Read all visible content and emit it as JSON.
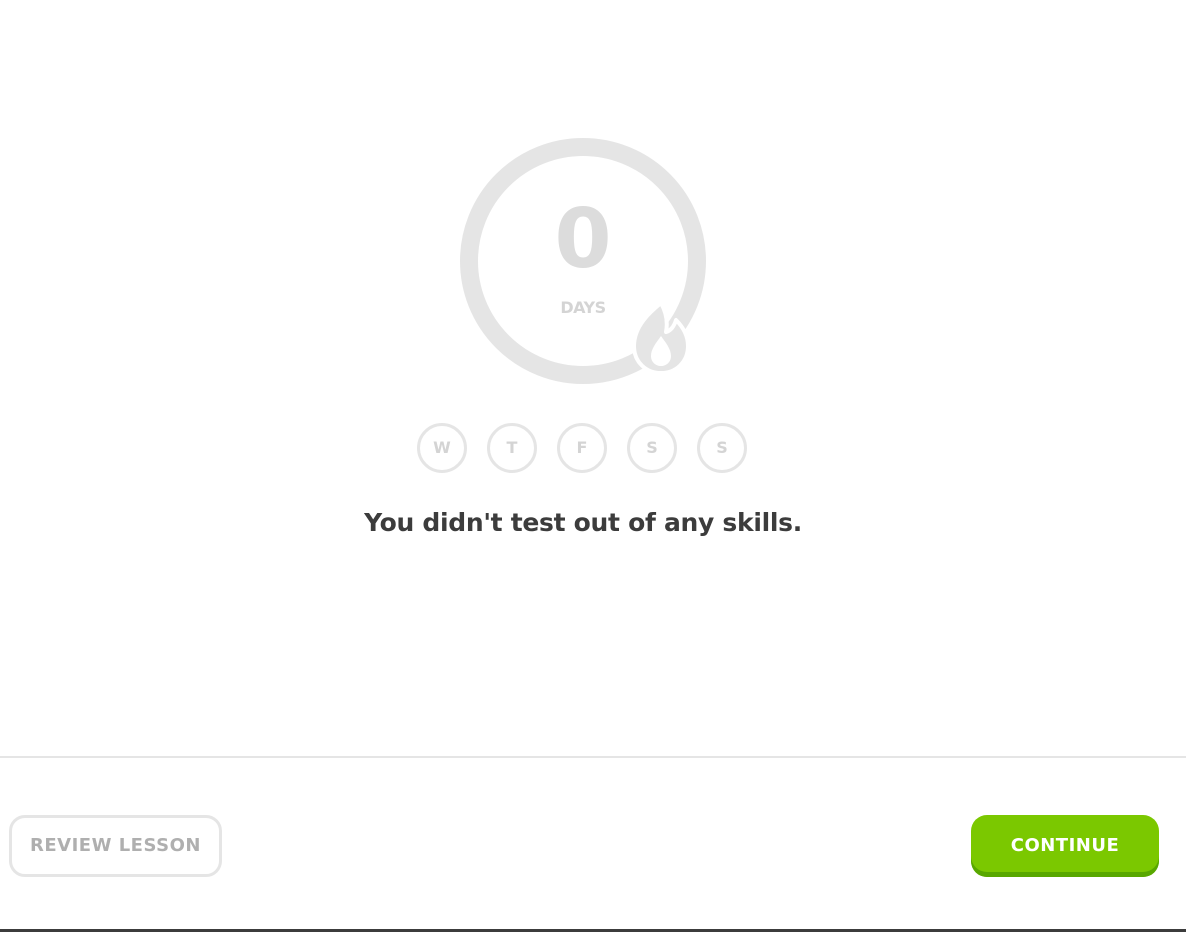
{
  "streak": {
    "count": "0",
    "unit_label": "DAYS",
    "ring_progress": 0.0,
    "icon": "flame-icon",
    "colors": {
      "ring": "#e5e5e5",
      "number": "#dcdcdc",
      "muted_text": "#d4d4d4"
    }
  },
  "weekdays": [
    {
      "label": "W"
    },
    {
      "label": "T"
    },
    {
      "label": "F"
    },
    {
      "label": "S"
    },
    {
      "label": "S"
    }
  ],
  "message": "You didn't test out of any skills.",
  "footer": {
    "review_label": "REVIEW LESSON",
    "continue_label": "CONTINUE",
    "colors": {
      "continue_bg": "#7bc800",
      "continue_shadow": "#58a700",
      "review_border": "#e5e5e5",
      "review_text": "#afafaf"
    }
  }
}
